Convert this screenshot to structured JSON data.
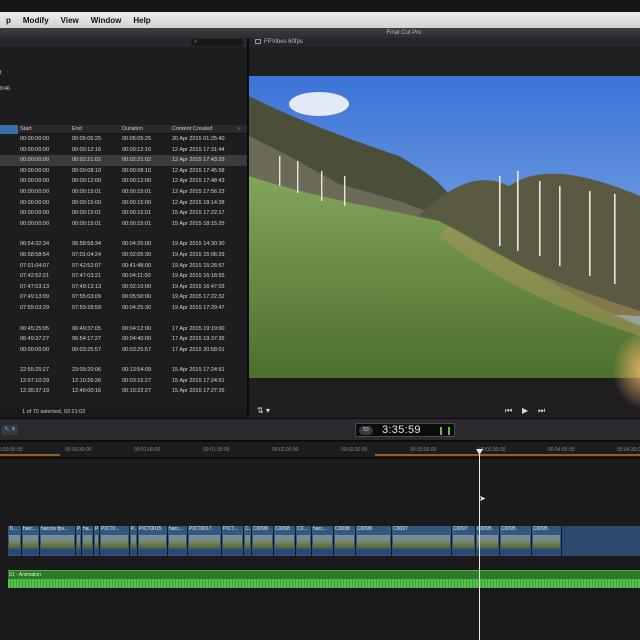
{
  "menu": [
    "p",
    "Modify",
    "View",
    "Window",
    "Help"
  ],
  "window_title": "Final Cut Pro",
  "browser": {
    "meta_line_a": "t",
    "meta_line_b": "0:46",
    "columns": [
      "Start",
      "End",
      "Duration",
      "Content Created"
    ],
    "rows": [
      {
        "start": "00:00:00:00",
        "end": "00:05:05:25",
        "duration": "00:05:05:25",
        "created": "20 Apr 2015 01:25:40",
        "selected": false
      },
      {
        "start": "00:00:00:00",
        "end": "00:00:12:16",
        "duration": "00:00:12:16",
        "created": "12 Apr 2015 17:31:44",
        "selected": false
      },
      {
        "start": "00:00:00:00",
        "end": "00:02:21:02",
        "duration": "00:02:21:02",
        "created": "12 Apr 2015 17:43:29",
        "selected": true
      },
      {
        "start": "00:00:00:00",
        "end": "00:00:08:10",
        "duration": "00:00:08:10",
        "created": "12 Apr 2015 17:45:58",
        "selected": false
      },
      {
        "start": "00:00:00:00",
        "end": "00:00:12:00",
        "duration": "00:00:12:00",
        "created": "12 Apr 2015 17:48:43",
        "selected": false
      },
      {
        "start": "00:00:00:00",
        "end": "00:00:15:01",
        "duration": "00:00:15:01",
        "created": "12 Apr 2015 17:56:23",
        "selected": false
      },
      {
        "start": "00:00:00:00",
        "end": "00:00:15:00",
        "duration": "00:00:15:00",
        "created": "12 Apr 2015 18:14:38",
        "selected": false
      },
      {
        "start": "00:00:00:00",
        "end": "00:00:15:01",
        "duration": "00:00:15:01",
        "created": "15 Apr 2015 17:22:17",
        "selected": false
      },
      {
        "start": "00:00:00:00",
        "end": "00:00:15:01",
        "duration": "00:00:15:01",
        "created": "15 Apr 2015 18:15:25",
        "selected": false
      },
      {
        "gap": true
      },
      {
        "start": "06:54:32:34",
        "end": "06:58:58:34",
        "duration": "00:04:26:00",
        "created": "19 Apr 2015 14:30:30",
        "selected": false
      },
      {
        "start": "06:58:58:54",
        "end": "07:01:04:24",
        "duration": "00:02:05:30",
        "created": "19 Apr 2015 15:06:29",
        "selected": false
      },
      {
        "start": "07:01:04:07",
        "end": "07:42:52:07",
        "duration": "00:41:48:00",
        "created": "19 Apr 2015 15:26:57",
        "selected": false
      },
      {
        "start": "07:42:52:21",
        "end": "07:47:03:21",
        "duration": "00:04:11:00",
        "created": "19 Apr 2015 16:18:55",
        "selected": false
      },
      {
        "start": "07:47:03:13",
        "end": "07:49:13:13",
        "duration": "00:02:10:00",
        "created": "19 Apr 2015 16:47:03",
        "selected": false
      },
      {
        "start": "07:49:13:09",
        "end": "07:55:03:09",
        "duration": "00:05:50:00",
        "created": "19 Apr 2015 17:22:32",
        "selected": false
      },
      {
        "start": "07:55:03:29",
        "end": "07:59:28:59",
        "duration": "00:04:25:30",
        "created": "19 Apr 2015 17:29:47",
        "selected": false
      },
      {
        "gap": true
      },
      {
        "start": "06:45:25:05",
        "end": "06:49:37:05",
        "duration": "00:04:12:00",
        "created": "17 Apr 2015 19:19:00",
        "selected": false
      },
      {
        "start": "06:49:37:27",
        "end": "06:54:17:27",
        "duration": "00:04:40:00",
        "created": "17 Apr 2015 19:37:35",
        "selected": false
      },
      {
        "start": "00:00:00:00",
        "end": "00:03:25:57",
        "duration": "00:03:25:57",
        "created": "17 Apr 2015 20:58:01",
        "selected": false
      },
      {
        "gap": true
      },
      {
        "start": "22:55:25:27",
        "end": "23:09:20:06",
        "duration": "00:13:54:09",
        "created": "15 Apr 2015 17:24:51",
        "selected": false
      },
      {
        "start": "12:07:10:29",
        "end": "12:10:26:26",
        "duration": "00:03:15:27",
        "created": "15 Apr 2015 17:24:51",
        "selected": false
      },
      {
        "start": "12:35:37:19",
        "end": "12:46:00:16",
        "duration": "00:10:22:27",
        "created": "15 Apr 2015 17:27:26",
        "selected": false
      }
    ],
    "footer": "1 of 70 selected, 02:21:02"
  },
  "viewer": {
    "title": "FPVibes 60fps",
    "controls": {
      "left": "⇅ ▾",
      "prev": "⏮",
      "play": "▶",
      "next": "⏭"
    }
  },
  "toolbar": {
    "tool": "↖ ▾",
    "timecode_badge": "53",
    "timecode": "3:35:59"
  },
  "ruler": {
    "labels": [
      "00:00:00:00",
      "00:00:30:00",
      "00:01:00:00",
      "00:01:30:00",
      "00:02:00:00",
      "00:02:30:00",
      "00:03:00:00",
      "00:03:30:00",
      "00:04:00:00",
      "00:04:30:00"
    ]
  },
  "timeline": {
    "clips": [
      {
        "label": "Ti..."
      },
      {
        "label": "harc..."
      },
      {
        "label": "harcov fpv..."
      },
      {
        "label": "P..."
      },
      {
        "label": "ha..."
      },
      {
        "label": "P..."
      },
      {
        "label": "PICT0..."
      },
      {
        "label": "P..."
      },
      {
        "label": "PICT0015"
      },
      {
        "label": "harc..."
      },
      {
        "label": "PICT0017"
      },
      {
        "label": "PICT..."
      },
      {
        "label": "C..."
      },
      {
        "label": "C0098"
      },
      {
        "label": "C0098"
      },
      {
        "label": "C0..."
      },
      {
        "label": "harc..."
      },
      {
        "label": "C0098"
      },
      {
        "label": "C0098"
      },
      {
        "label": "C0097"
      },
      {
        "label": "C0097"
      },
      {
        "label": "C0095"
      },
      {
        "label": "C0095"
      },
      {
        "label": "C0095"
      }
    ],
    "music_label": "01 - Animation"
  },
  "colors": {
    "selection": "#3a6ea5",
    "clip": "#35587f",
    "audio": "#2e7a2a",
    "ruler_band": "#a25a1d"
  }
}
